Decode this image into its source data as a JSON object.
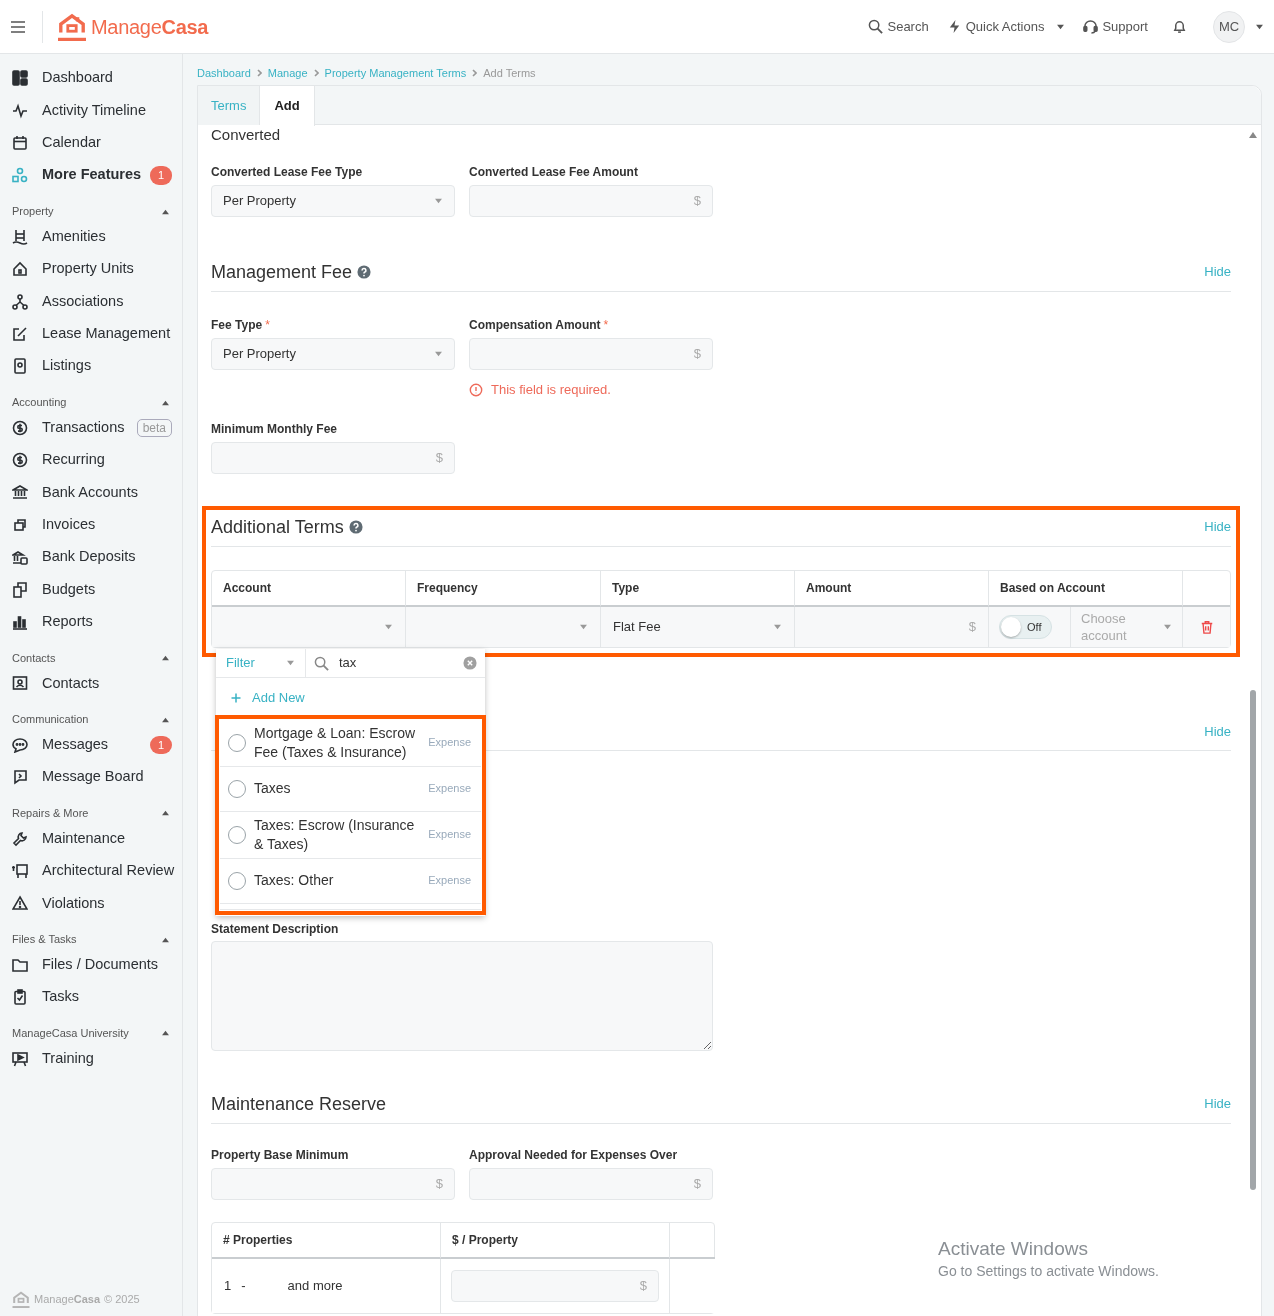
{
  "topbar": {
    "logo": "Manage**Casa**",
    "actions": [
      {
        "label": "Search",
        "kind": "search"
      },
      {
        "label": "Quick Actions",
        "kind": "quick"
      },
      {
        "label": "Support",
        "kind": "support"
      }
    ],
    "avatar": "MC"
  },
  "sidebar": {
    "items": [
      {
        "label": "Dashboard",
        "highlighted": false
      },
      {
        "label": "Activity Timeline",
        "highlighted": false
      },
      {
        "label": "Calendar",
        "highlighted": false
      },
      {
        "label": "More Features",
        "highlighted": true,
        "badge": "1"
      }
    ],
    "groups": [
      {
        "title": "Property",
        "expanded": true,
        "items": [
          {
            "label": "Amenities"
          },
          {
            "label": "Property Units"
          },
          {
            "label": "Associations"
          },
          {
            "label": "Lease Management"
          },
          {
            "label": "Listings"
          }
        ]
      },
      {
        "title": "Accounting",
        "expanded": true,
        "items": [
          {
            "label": "Transactions",
            "tag": "beta"
          },
          {
            "label": "Recurring"
          },
          {
            "label": "Bank Accounts"
          },
          {
            "label": "Invoices"
          },
          {
            "label": "Bank Deposits"
          },
          {
            "label": "Budgets"
          },
          {
            "label": "Reports"
          }
        ]
      },
      {
        "title": "Contacts",
        "expanded": true,
        "items": [
          {
            "label": "Contacts"
          }
        ]
      },
      {
        "title": "Communication",
        "expanded": true,
        "items": [
          {
            "label": "Messages",
            "badge": "1"
          },
          {
            "label": "Message Board"
          }
        ]
      },
      {
        "title": "Repairs & More",
        "expanded": true,
        "items": [
          {
            "label": "Maintenance"
          },
          {
            "label": "Architectural Review"
          },
          {
            "label": "Violations"
          }
        ]
      },
      {
        "title": "Files & Tasks",
        "expanded": true,
        "items": [
          {
            "label": "Files / Documents"
          },
          {
            "label": "Tasks"
          }
        ]
      },
      {
        "title": "ManageCasa University",
        "expanded": true,
        "items": [
          {
            "label": "Training"
          }
        ]
      }
    ],
    "footer": {
      "brand": "Manage**Casa**",
      "copyright": "© 2025"
    }
  },
  "breadcrumb": [
    {
      "label": "Dashboard",
      "link": true
    },
    {
      "label": "Manage",
      "link": true
    },
    {
      "label": "Property Management Terms",
      "link": true
    },
    {
      "label": "Add Terms",
      "link": false
    }
  ],
  "tabs": [
    {
      "label": "Terms",
      "selected": false
    },
    {
      "label": "Add",
      "selected": true
    }
  ],
  "converted": {
    "title": "Converted",
    "fields": [
      {
        "label": "Converted Lease Fee Type",
        "kind": "select",
        "value": "Per Property"
      },
      {
        "label": "Converted Lease Fee Amount",
        "kind": "money",
        "suffix": "$"
      }
    ]
  },
  "management_fee": {
    "title": "Management Fee",
    "hide": "Hide",
    "fields": [
      {
        "label": "Fee Type",
        "required_mark": "*",
        "kind": "select",
        "value": "Per Property"
      },
      {
        "label": "Compensation Amount",
        "required_mark": "*",
        "kind": "money",
        "suffix": "$",
        "error": "This field is required."
      },
      {
        "label": "Minimum Monthly Fee",
        "kind": "money",
        "suffix": "$"
      }
    ]
  },
  "additional_terms": {
    "title": "Additional Terms",
    "hide": "Hide",
    "highlighted": true,
    "columns": [
      "Account",
      "Frequency",
      "Type",
      "Amount",
      "Based on Account"
    ],
    "row": {
      "type": "Flat Fee",
      "amount_suffix": "$",
      "toggle": {
        "label": "Off",
        "on": false
      },
      "account_placeholder": "Choose account"
    }
  },
  "account_dropdown": {
    "filter": "Filter",
    "search": "tax",
    "add_new": "Add New",
    "highlighted": true,
    "options": [
      {
        "label": "Mortgage & Loan: Escrow Fee (Taxes & Insurance)",
        "type": "Expense",
        "selected": false
      },
      {
        "label": "Taxes",
        "type": "Expense",
        "selected": false
      },
      {
        "label": "Taxes: Escrow (Insurance & Taxes)",
        "type": "Expense",
        "selected": false
      },
      {
        "label": "Taxes: Other",
        "type": "Expense",
        "selected": false
      }
    ]
  },
  "covered_section": {
    "hide": "Hide"
  },
  "statement_description": {
    "label": "Statement Description"
  },
  "maintenance_reserve": {
    "title": "Maintenance Reserve",
    "hide": "Hide",
    "fields": [
      {
        "label": "Property Base Minimum",
        "kind": "money",
        "suffix": "$"
      },
      {
        "label": "Approval Needed for Expenses Over",
        "kind": "money",
        "suffix": "$"
      }
    ],
    "columns": [
      "# Properties",
      "$ / Property"
    ],
    "row": {
      "from": "1",
      "dash": "-",
      "to": "and more",
      "suffix": "$"
    }
  },
  "os_overlay": {
    "title": "Activate Windows",
    "subtitle": "Go to Settings to activate Windows."
  }
}
